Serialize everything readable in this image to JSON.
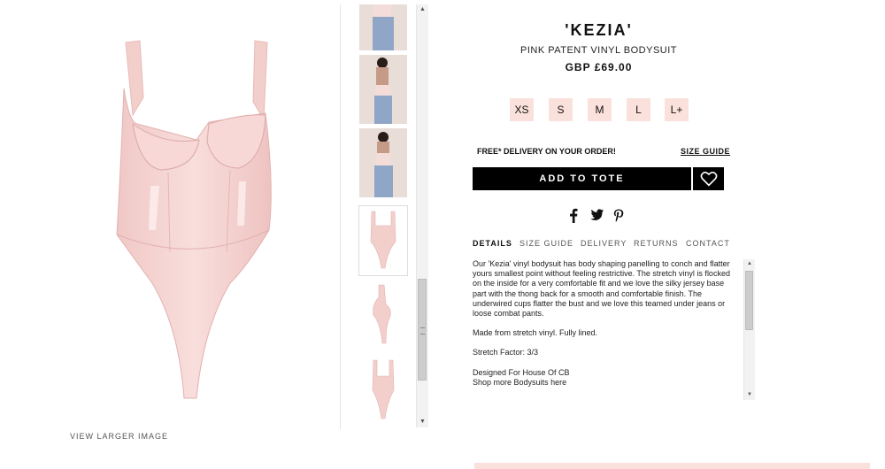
{
  "gallery": {
    "view_larger_label": "VIEW LARGER IMAGE"
  },
  "product": {
    "name": "'KEZIA'",
    "subtitle": "PINK PATENT VINYL BODYSUIT",
    "price": "GBP £69.00",
    "sizes": [
      "XS",
      "S",
      "M",
      "L",
      "L+"
    ],
    "delivery_text": "FREE* DELIVERY ON YOUR ORDER!",
    "size_guide_link": "SIZE GUIDE",
    "add_to_tote_label": "ADD TO TOTE"
  },
  "tabs": [
    "DETAILS",
    "SIZE GUIDE",
    "DELIVERY",
    "RETURNS",
    "CONTACT"
  ],
  "details": {
    "paragraph1": "Our 'Kezia' vinyl bodysuit has body shaping panelling to conch and flatter yours smallest point without feeling restrictive. The stretch vinyl is flocked on the inside for a very comfortable fit and we love the silky jersey base part with the thong back for a smooth and comfortable finish. The underwired cups flatter the bust and we love this teamed under jeans or loose combat pants.",
    "paragraph2": "Made from stretch vinyl. Fully lined.",
    "paragraph3": "Stretch Factor: 3/3",
    "designed_for": "Designed For House Of CB",
    "shop_more_prefix": "Shop more",
    "shop_more_link": "Bodysuits",
    "shop_more_suffix": "here"
  },
  "colors": {
    "product_pink": "#f3cfcc",
    "accent_pink": "#fbe1db",
    "button_black": "#000000"
  },
  "icons": [
    "facebook-icon",
    "twitter-icon",
    "pinterest-icon",
    "heart-icon"
  ]
}
